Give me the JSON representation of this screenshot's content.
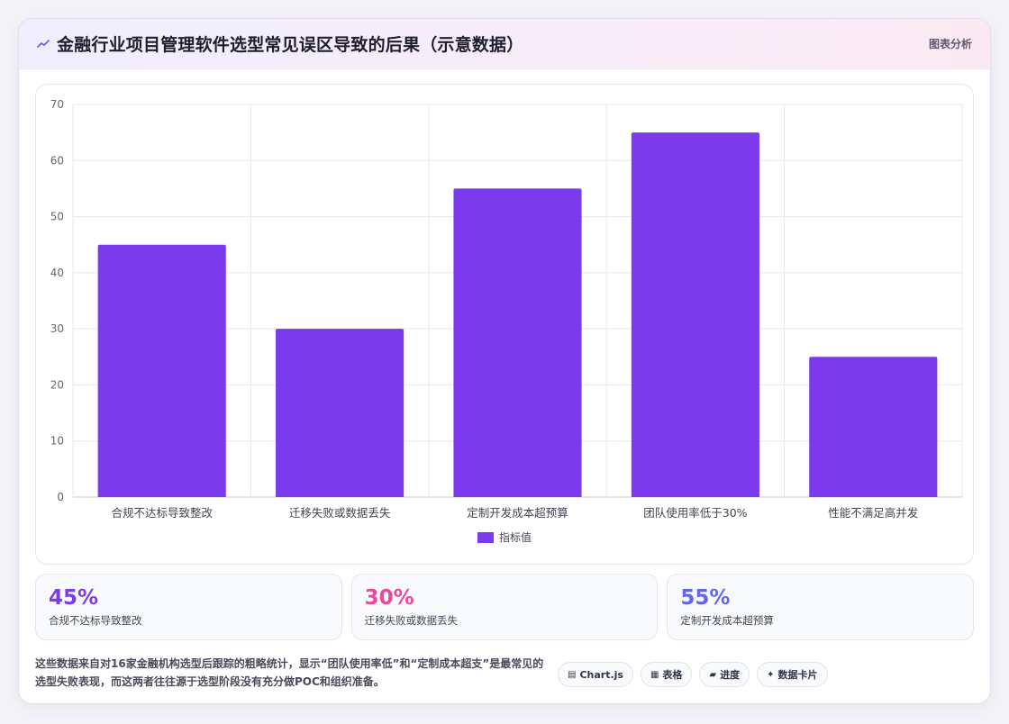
{
  "header": {
    "title": "金融行业项目管理软件选型常见误区导致的后果（示意数据）",
    "tag": "图表分析"
  },
  "chart_data": {
    "type": "bar",
    "categories": [
      "合规不达标导致整改",
      "迁移失败或数据丢失",
      "定制开发成本超预算",
      "团队使用率低于30%",
      "性能不满足高并发"
    ],
    "series": [
      {
        "name": "指标值",
        "values": [
          45,
          30,
          55,
          65,
          25
        ],
        "color": "#7c3aed"
      }
    ],
    "ylim": [
      0,
      70
    ],
    "yticks": [
      0,
      10,
      20,
      30,
      40,
      50,
      60,
      70
    ],
    "grid": true,
    "legend": "bottom"
  },
  "stats": [
    {
      "value": "45%",
      "label": "合规不达标导致整改",
      "color": "#7c3aed"
    },
    {
      "value": "30%",
      "label": "迁移失败或数据丢失",
      "color": "#ec4899"
    },
    {
      "value": "55%",
      "label": "定制开发成本超预算",
      "color": "#6366f1"
    }
  ],
  "footer": {
    "text": "这些数据来自对16家金融机构选型后跟踪的粗略统计，显示“团队使用率低”和“定制成本超支”是最常见的选型失败表现，而这两者往往源于选型阶段没有充分做POC和组织准备。",
    "pills": [
      {
        "icon": "chart-icon",
        "glyph": "▤",
        "label": "Chart.js"
      },
      {
        "icon": "table-icon",
        "glyph": "▦",
        "label": "表格"
      },
      {
        "icon": "progress-icon",
        "glyph": "▰",
        "label": "进度"
      },
      {
        "icon": "card-icon",
        "glyph": "✦",
        "label": "数据卡片"
      }
    ]
  }
}
